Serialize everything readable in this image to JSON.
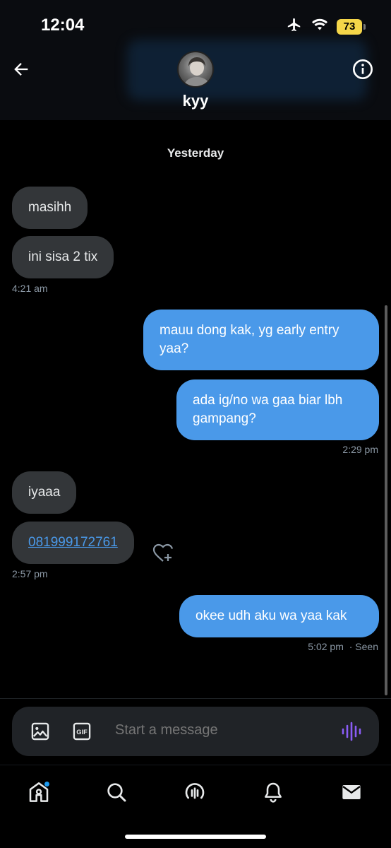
{
  "status_bar": {
    "time": "12:04",
    "battery_level": "73",
    "icons": [
      "airplane-icon",
      "wifi-icon",
      "battery-icon"
    ]
  },
  "header": {
    "contact_name": "kyy",
    "back_icon": "arrow-left-icon",
    "info_icon": "info-icon"
  },
  "conversation": {
    "day_label": "Yesterday",
    "messages": [
      {
        "direction": "in",
        "text": "masihh"
      },
      {
        "direction": "in",
        "text": "ini sisa 2 tix",
        "time": "4:21 am"
      },
      {
        "direction": "out",
        "text": "mauu dong kak, yg early entry yaa?"
      },
      {
        "direction": "out",
        "text": "ada ig/no wa gaa biar lbh gampang?",
        "time": "2:29 pm"
      },
      {
        "direction": "in",
        "text": "iyaaa"
      },
      {
        "direction": "in",
        "text": "081999172761",
        "is_link": true,
        "time": "2:57 pm"
      },
      {
        "direction": "out",
        "text": "okee udh aku wa yaa kak",
        "time": "5:02 pm",
        "status": "· Seen"
      }
    ]
  },
  "composer": {
    "placeholder": "Start a message",
    "icons": [
      "image-icon",
      "gif-icon",
      "voice-message-icon"
    ],
    "gif_label": "GIF"
  },
  "tabbar": {
    "items": [
      "home-icon",
      "search-icon",
      "spaces-icon",
      "notifications-icon",
      "messages-icon"
    ]
  },
  "colors": {
    "accent": "#4a99e9",
    "incoming_bubble": "#333639",
    "background": "#000000",
    "voice_icon": "#8a5cf6"
  }
}
